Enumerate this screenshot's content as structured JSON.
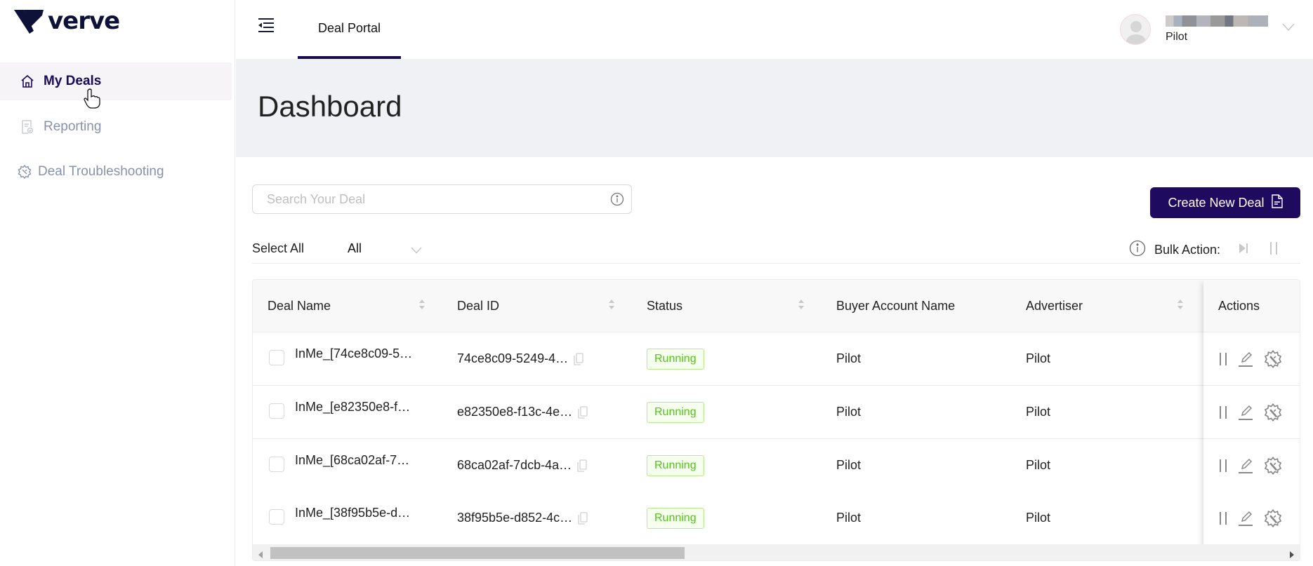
{
  "brand": {
    "name": "verve",
    "color": "#0f1238"
  },
  "sidebar": {
    "items": [
      {
        "label": "My Deals",
        "icon": "home-icon",
        "active": true
      },
      {
        "label": "Reporting",
        "icon": "report-icon",
        "active": false
      },
      {
        "label": "Deal Troubleshooting",
        "icon": "gear-wrench-icon",
        "active": false
      }
    ]
  },
  "header": {
    "tab_label": "Deal Portal",
    "user": {
      "name": "[blurred]",
      "role": "Pilot"
    }
  },
  "page": {
    "title": "Dashboard"
  },
  "toolbar": {
    "search_placeholder": "Search Your Deal",
    "search_value": "",
    "create_label": "Create New Deal",
    "select_all_label": "Select All",
    "filter_value": "All",
    "bulk_action_label": "Bulk Action:"
  },
  "table": {
    "columns": [
      "Deal Name",
      "Deal ID",
      "Status",
      "Buyer Account Name",
      "Advertiser",
      "Actions"
    ],
    "rows": [
      {
        "deal_name": "InMe_[74ce8c09-5…",
        "deal_id": "74ce8c09-5249-4…",
        "status": "Running",
        "buyer": "Pilot",
        "advertiser": "Pilot"
      },
      {
        "deal_name": "InMe_[e82350e8-f…",
        "deal_id": "e82350e8-f13c-4e…",
        "status": "Running",
        "buyer": "Pilot",
        "advertiser": "Pilot"
      },
      {
        "deal_name": "InMe_[68ca02af-7…",
        "deal_id": "68ca02af-7dcb-4a…",
        "status": "Running",
        "buyer": "Pilot",
        "advertiser": "Pilot"
      },
      {
        "deal_name": "InMe_[38f95b5e-d…",
        "deal_id": "38f95b5e-d852-4c…",
        "status": "Running",
        "buyer": "Pilot",
        "advertiser": "Pilot"
      }
    ]
  },
  "colors": {
    "accent": "#1e0a5e",
    "running_text": "#52c41a",
    "running_bg": "#f6ffed",
    "running_border": "#b7eb8f"
  }
}
